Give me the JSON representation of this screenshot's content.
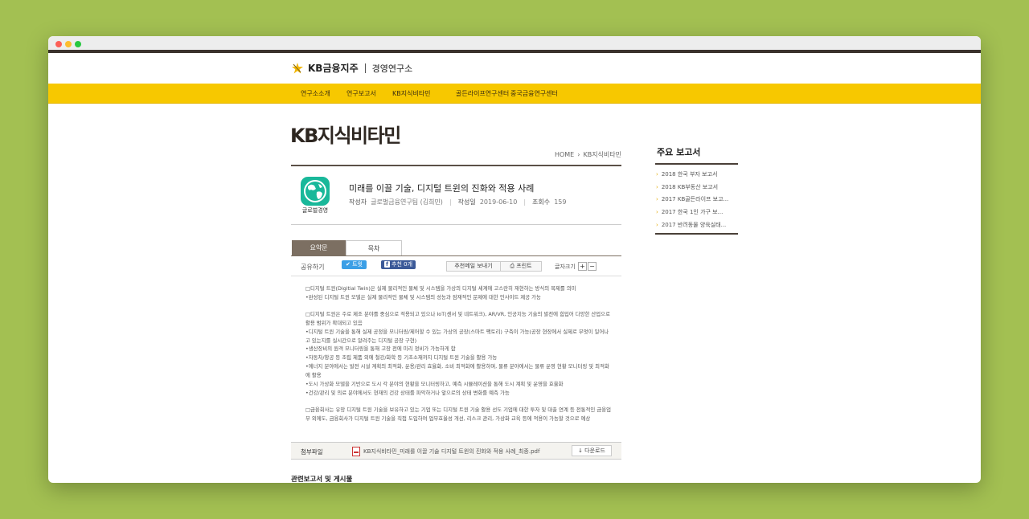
{
  "header": {
    "logo_kb": "KB금융지주",
    "logo_sub": "경영연구소"
  },
  "nav": {
    "items": [
      {
        "label": "연구소소개"
      },
      {
        "label": "연구보고서"
      },
      {
        "label": "KB지식비타민"
      },
      {
        "label": "골든라이프연구센터"
      },
      {
        "label": "중국금융연구센터"
      }
    ]
  },
  "page": {
    "title": "KB지식비타민",
    "breadcrumb": [
      "HOME",
      "KB지식비타민"
    ]
  },
  "article": {
    "icon_label": "글로벌경영",
    "title": "미래를 이끌 기술, 디지털 트윈의 진화와 적용 사례",
    "author_label": "작성자",
    "author": "글로벌금융연구팀 (김희민)",
    "date_label": "작성일",
    "date": "2019-06-10",
    "views_label": "조회수",
    "views": "159"
  },
  "tabs": [
    {
      "label": "요약문"
    },
    {
      "label": "목차"
    }
  ],
  "share": {
    "label": "공유하기",
    "twitter": "트윗",
    "facebook": "추천 0개",
    "mail": "추천메일 보내기",
    "print": "프린트",
    "font_size_label": "글자크기",
    "plus": "+",
    "minus": "−"
  },
  "body": {
    "p1": [
      "□디지털 트윈(Digitial Twin)은 실제 물리적인 물체 및 시스템을 가상의 디지털 세계에 고스란히 재현하는 방식의 복제를 의미",
      "•완성된 디지털 트윈 모델은 실제 물리적인 물체 및 시스템의 성능과 잠재적인 문제에 대한 인사이트 제공 가능"
    ],
    "p2": [
      "□디지털 트윈은 주로 제조 분야를 중심으로 적용되고 있으나 IoT(센서 및 네트워크), AR/VR, 인공지능 기술의 발전에 힘입어 다양한 산업으로 활용 범위가 확대되고 있음",
      "•디지털 트윈 기술을 통해 실제 공정을 모니터링/제어할 수 있는 가상의 공장(스마트 팩토리) 구축이 가능(공장 현장에서 실제로 무엇이 일어나고 있는지를 실시간으로 알려주는 디지털 공장 구현)",
      "•생산장비의 원격 모니터링을 통해 고장 전에 미리 정비가 가능하게 함",
      "•자동차/항공 등 조립 제품 외에 철강/화학 등 기초소재까지 디지털 트윈 기술을 활용 가능",
      "•에너지 분야에서는 발전 시설 계획의 최적화, 운용/관리 효율화, 소비 최적화에 활용하며, 물류 분야에서는 물류 운영 현황 모니터링 및 최적화에 활용",
      "•도시 가상화 모델을 기반으로 도시 각 분야의 현황을 모니터링하고, 예측 시뮬레이션을 통해 도시 계획 및 운영을 효율화",
      "•건강/관리 및 의료 분야에서도 현재의 건강 상태를 파악하거나 앞으로의 상태 변화를 예측 가능"
    ],
    "p3": [
      "□금융회사는 유망 디지털 트윈 기술을 보유하고 있는 기업 또는 디지털 트윈 기술 활용 선도 기업에 대한 투자 및 대출 연계 등 전통적인 금융업무 외에도, 금융회사가 디지털 트윈 기술을 직접 도입하여 업무효율성 개선, 리스크 관리, 가상화 교육 등에 적용이 가능할 것으로 예상"
    ]
  },
  "attachment": {
    "label": "첨부파일",
    "file": "KB지식비타민_미래를 이끌 기술 디지털 트윈의 진화와 적용 사례_최종.pdf",
    "download": "↓ 다운로드"
  },
  "related_title": "관련보고서 및 게시물",
  "sidebar": {
    "title": "주요 보고서",
    "items": [
      {
        "label": "2018 한국 부자 보고서"
      },
      {
        "label": "2018 KB부동산 보고서"
      },
      {
        "label": "2017 KB골든라이프 보고..."
      },
      {
        "label": "2017 한국 1인 가구 보..."
      },
      {
        "label": "2017 반려동물 양육실태..."
      }
    ]
  },
  "colors": {
    "background": "#a3c052",
    "nav_yellow": "#f7c800",
    "tab_active": "#7c6f62",
    "icon_teal": "#19b89a"
  }
}
